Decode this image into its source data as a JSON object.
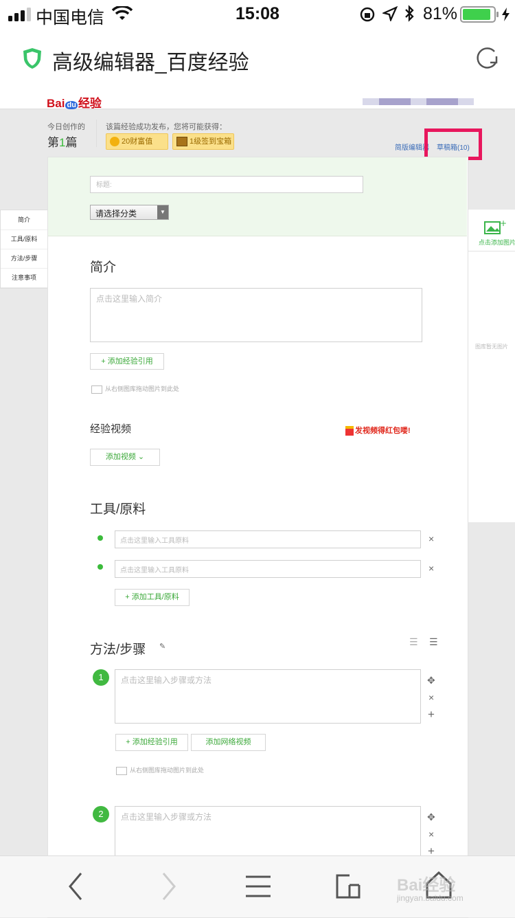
{
  "status": {
    "carrier": "中国电信",
    "time": "15:08",
    "battery": "81%"
  },
  "browser": {
    "title": "高级编辑器_百度经验"
  },
  "header": {
    "logo": "Bai",
    "logo_suffix": "经验"
  },
  "counter": {
    "label": "今日创作的",
    "value_prefix": "第",
    "value_num": "1",
    "value_suffix": "篇"
  },
  "reward": {
    "label": "该篇经验成功发布，您将可能获得：",
    "coins": "20财富值",
    "chest": "1级签到宝箱"
  },
  "links": {
    "simple_editor": "简版编辑器",
    "drafts": "草稿箱(10)"
  },
  "form": {
    "title_placeholder": "标题:",
    "category": "请选择分类",
    "intro_heading": "简介",
    "intro_placeholder": "点击这里输入简介",
    "add_ref": "+ 添加经验引用",
    "drag_hint": "从右侧图库拖动图片到此处",
    "video_heading": "经验视频",
    "video_promo": "发视频得红包喽!",
    "add_video": "添加视频 ⌄",
    "tools_heading": "工具/原料",
    "tool_placeholder": "点击这里输入工具原料",
    "add_tool": "+ 添加工具/原料",
    "steps_heading": "方法/步骤",
    "step_placeholder": "点击这里输入步骤或方法",
    "add_web_video": "添加网络视频"
  },
  "sidenav": [
    "简介",
    "工具/原料",
    "方法/步骤",
    "注意事项"
  ],
  "rpanel": {
    "add_image": "点击添加图片",
    "empty": "图库暂无图片"
  },
  "watermark": {
    "main": "Bai经验",
    "sub": "jingyan.baidu.com"
  },
  "colors": {
    "green": "#3bbb3b",
    "highlight": "#e8175d",
    "link": "#3a6cb8"
  }
}
